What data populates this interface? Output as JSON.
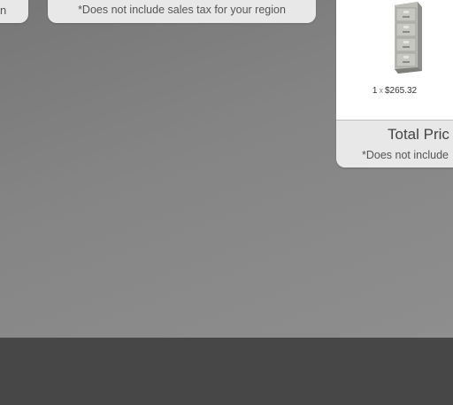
{
  "left_card": {
    "fragment": "n"
  },
  "middle_card": {
    "tax_note": "*Does not include sales tax for your region"
  },
  "right_card": {
    "product": {
      "image_icon": "file-cabinet-icon",
      "quantity": "1",
      "times": "x",
      "price": "$265.32"
    },
    "total_label": "Total Pric",
    "tax_note": "*Does not include"
  },
  "colors": {
    "background_gradient_start": "#777777",
    "background_gradient_end": "#8e8e8e",
    "card_footer": "#e8e8e8",
    "footer_bar": "#474747"
  }
}
